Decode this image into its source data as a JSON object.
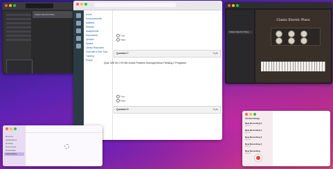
{
  "logic": {
    "track_name": "Classic Electric Piano"
  },
  "browser": {
    "url": "",
    "course_nav": [
      "Home",
      "Announcements",
      "Syllabus",
      "Modules",
      "Assignments",
      "Discussions",
      "Quizzes",
      "Grades",
      "Library Resources",
      "Chat with a Peer Tutor",
      "Tutoring",
      "People"
    ],
    "quiz_title": "Quiz: WK 05 CYS 5th Grade Problem Solving/Critical Thinking 2 Programs",
    "questions": [
      {
        "label": "Question 7",
        "points": "5 pts",
        "options": [
          "True",
          "False"
        ]
      },
      {
        "label": "Question 8",
        "points": "5 pts",
        "options": [
          "True",
          "False"
        ]
      },
      {
        "label": "Question 9",
        "points": "5 pts",
        "options": []
      }
    ]
  },
  "library": {
    "instrument_title": "Classic Electric Piano",
    "selected_patch": "Classic Electric Piano"
  },
  "finder": {
    "sidebar": [
      "Recents",
      "Applications",
      "Desktop",
      "Documents",
      "Downloads",
      "iCloud Drive"
    ],
    "selected": "iCloud Drive"
  },
  "voice_memos": {
    "title": "All Recordings",
    "items": [
      {
        "title": "New Recording 5",
        "date": "Oct 14"
      },
      {
        "title": "New Recording 4",
        "date": "Oct 14"
      },
      {
        "title": "New Recording 3",
        "date": "Oct 14"
      },
      {
        "title": "New Recording 2",
        "date": "Oct 14"
      },
      {
        "title": "New Recording",
        "date": "Oct 14"
      }
    ]
  },
  "colors": {
    "record": "#ff3b30",
    "canvas_nav": "#2d3b45",
    "link": "#1a5fa3"
  }
}
